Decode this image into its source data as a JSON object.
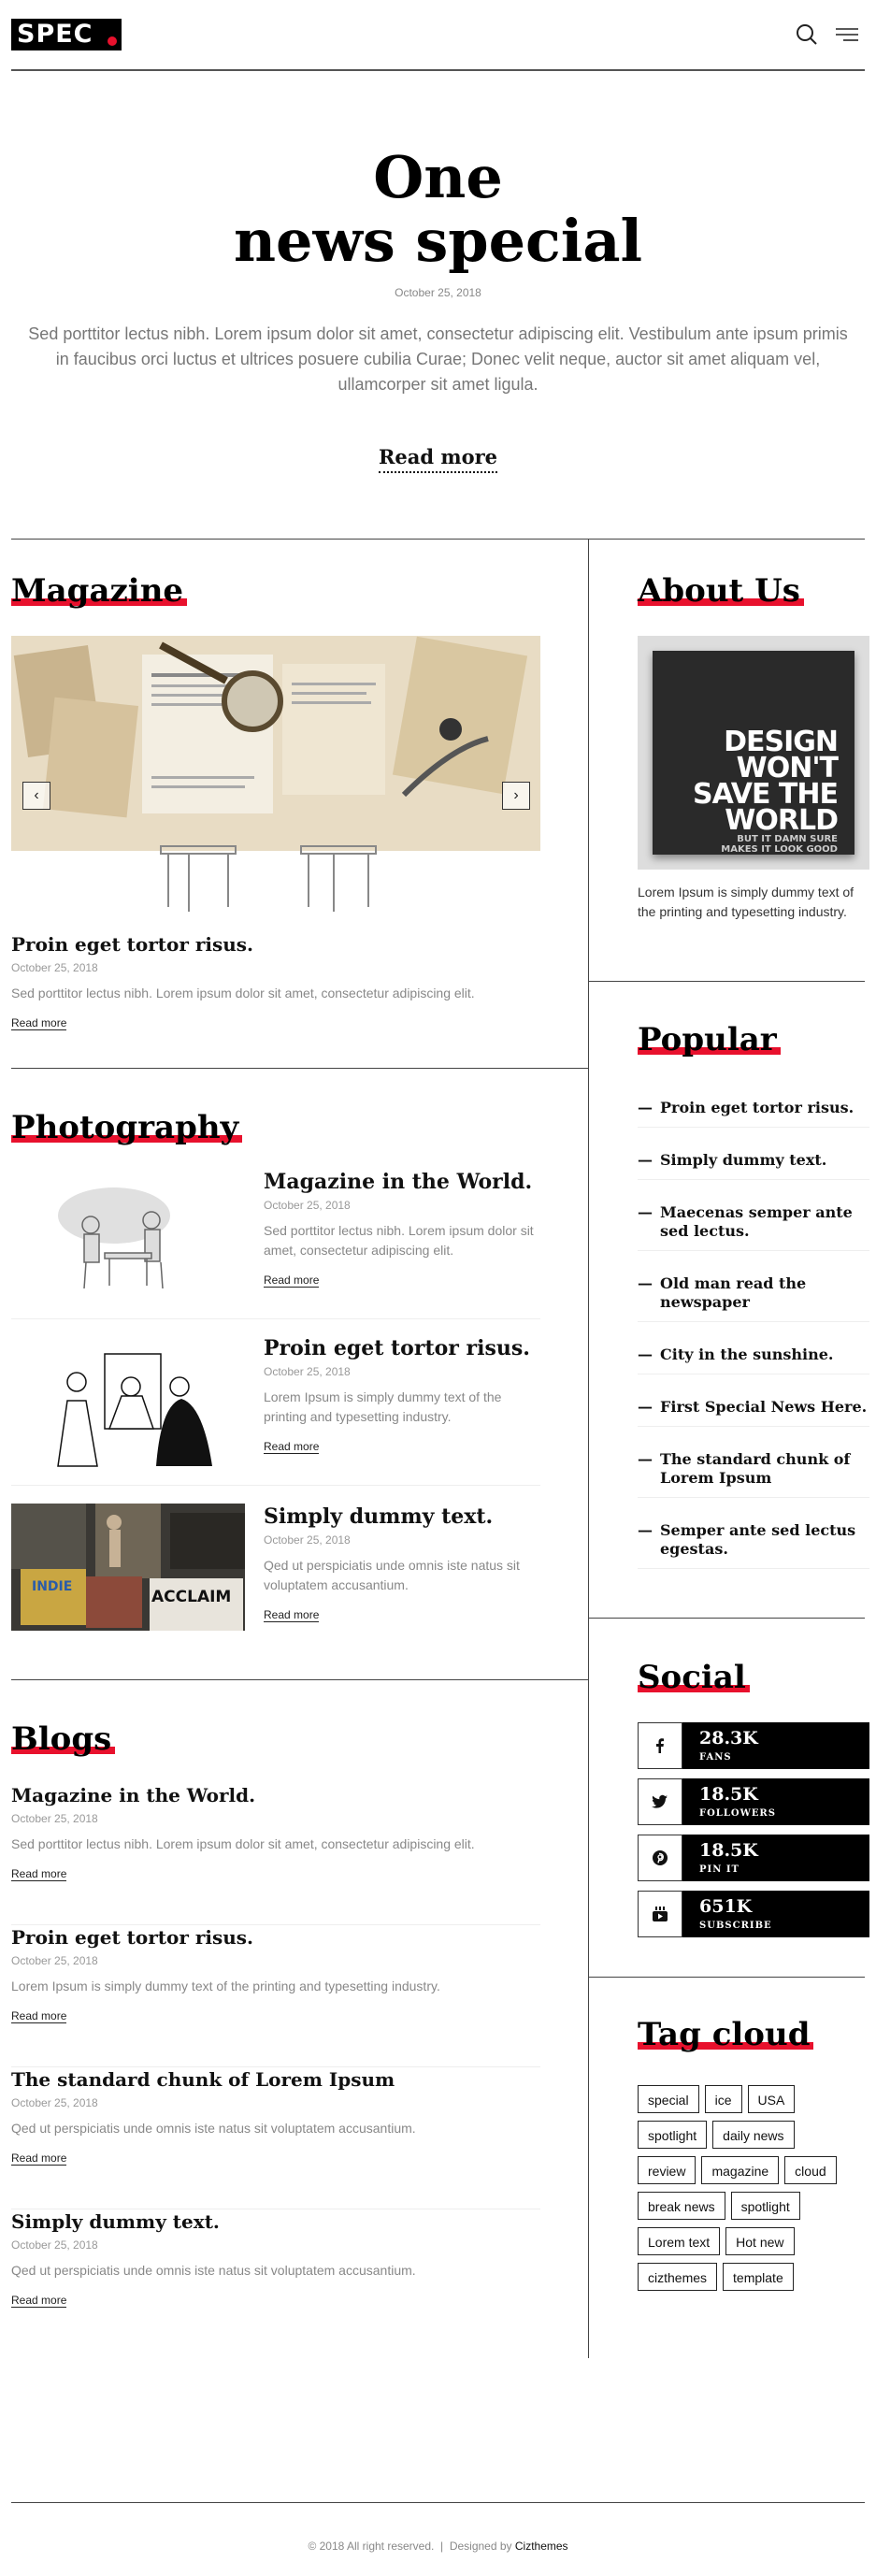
{
  "header": {
    "logo": "SPEC",
    "search_icon": "search-icon",
    "menu_icon": "menu-icon"
  },
  "hero": {
    "title_line1": "One",
    "title_line2": "news special",
    "date": "October 25, 2018",
    "description": "Sed porttitor lectus nibh. Lorem ipsum dolor sit amet, consectetur adipiscing elit. Vestibulum ante ipsum primis in faucibus orci luctus et ultrices posuere cubilia Curae; Donec velit neque, auctor sit amet aliquam vel, ullamcorper sit amet ligula.",
    "read_more": "Read more"
  },
  "magazine": {
    "title": "Magazine",
    "post": {
      "title": "Proin eget tortor risus.",
      "date": "October 25, 2018",
      "text": "Sed porttitor lectus nibh. Lorem ipsum dolor sit amet, consectetur adipiscing elit.",
      "read_more": "Read more"
    }
  },
  "photography": {
    "title": "Photography",
    "items": [
      {
        "title": "Magazine in the World.",
        "date": "October 25, 2018",
        "text": "Sed porttitor lectus nibh. Lorem ipsum dolor sit amet, consectetur adipiscing elit.",
        "read_more": "Read more"
      },
      {
        "title": "Proin eget tortor risus.",
        "date": "October 25, 2018",
        "text": "Lorem Ipsum is simply dummy text of the printing and typesetting industry.",
        "read_more": "Read more"
      },
      {
        "title": "Simply dummy text.",
        "date": "October 25, 2018",
        "text": "Qed ut perspiciatis unde omnis iste natus sit voluptatem accusantium.",
        "read_more": "Read more"
      }
    ],
    "shop_signs": [
      "INDIE",
      "ACCLAIM"
    ]
  },
  "blogs": {
    "title": "Blogs",
    "items": [
      {
        "title": "Magazine in the World.",
        "date": "October 25, 2018",
        "text": "Sed porttitor lectus nibh. Lorem ipsum dolor sit amet, consectetur adipiscing elit.",
        "read_more": "Read more"
      },
      {
        "title": "Proin eget tortor risus.",
        "date": "October 25, 2018",
        "text": "Lorem Ipsum is simply dummy text of the printing and typesetting industry.",
        "read_more": "Read more"
      },
      {
        "title": "The standard chunk of Lorem Ipsum",
        "date": "October 25, 2018",
        "text": "Qed ut perspiciatis unde omnis iste natus sit voluptatem accusantium.",
        "read_more": "Read more"
      },
      {
        "title": "Simply dummy text.",
        "date": "October 25, 2018",
        "text": "Qed ut perspiciatis unde omnis iste natus sit voluptatem accusantium.",
        "read_more": "Read more"
      }
    ]
  },
  "about": {
    "title": "About Us",
    "image_big": [
      "DESIGN",
      "WON'T",
      "SAVE THE",
      "WORLD"
    ],
    "image_small": [
      "BUT IT DAMN SURE",
      "MAKES IT LOOK GOOD"
    ],
    "text": "Lorem Ipsum is simply dummy text of the printing and typesetting industry."
  },
  "popular": {
    "title": "Popular",
    "items": [
      "Proin eget tortor risus.",
      "Simply dummy text.",
      "Maecenas semper ante sed lectus.",
      "Old man read the newspaper",
      "City in the sunshine.",
      "First Special News Here.",
      "The standard chunk of Lorem Ipsum",
      "Semper ante sed lectus egestas."
    ]
  },
  "social": {
    "title": "Social",
    "items": [
      {
        "icon": "facebook-icon",
        "count": "28.3K",
        "label": "FANS"
      },
      {
        "icon": "twitter-icon",
        "count": "18.5K",
        "label": "FOLLOWERS"
      },
      {
        "icon": "pinterest-icon",
        "count": "18.5K",
        "label": "PIN IT"
      },
      {
        "icon": "youtube-icon",
        "count": "651K",
        "label": "SUBSCRIBE"
      }
    ]
  },
  "tags": {
    "title": "Tag cloud",
    "items": [
      "special",
      "ice",
      "USA",
      "spotlight",
      "daily news",
      "review",
      "magazine",
      "cloud",
      "break news",
      "spotlight",
      "Lorem text",
      "Hot new",
      "cizthemes",
      "template"
    ]
  },
  "footer": {
    "copyright": "© 2018 All right reserved.",
    "designed_by": "Designed by",
    "brand": "Cizthemes"
  },
  "colors": {
    "accent": "#e8112d",
    "dark": "#000000",
    "text_muted": "#888888"
  }
}
